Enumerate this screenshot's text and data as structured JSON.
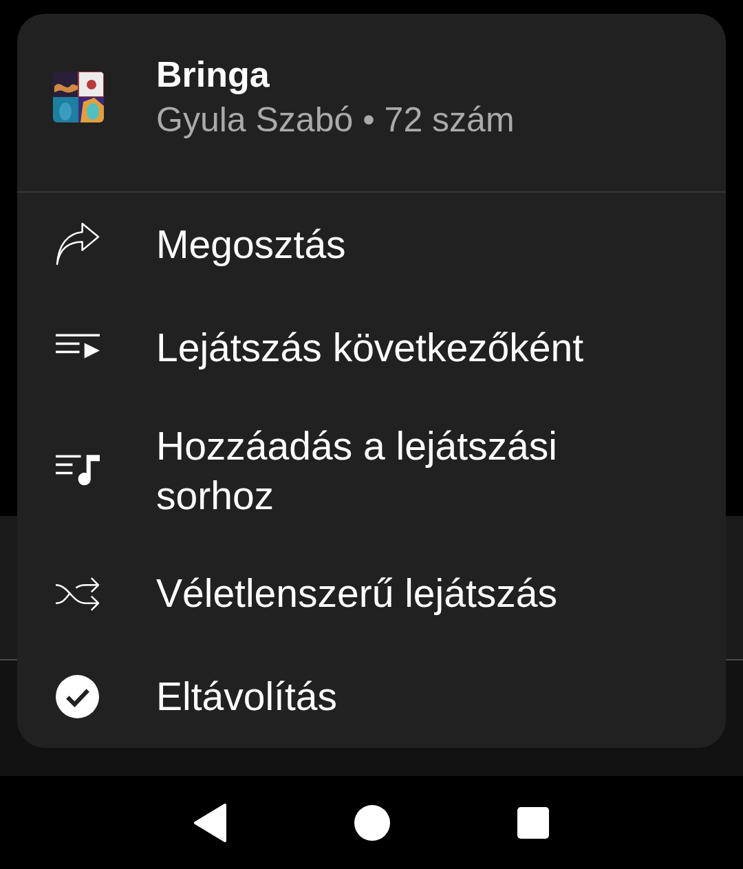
{
  "menu": {
    "header": {
      "title": "Bringa",
      "subtitle": "Gyula Szabó • 72 szám"
    },
    "items": [
      {
        "kind": "share",
        "label": "Megosztás"
      },
      {
        "kind": "play-next",
        "label": "Lejátszás következőként"
      },
      {
        "kind": "add-queue",
        "label": "Hozzáadás a lejátszási sorhoz"
      },
      {
        "kind": "shuffle",
        "label": "Véletlenszerű lejátszás"
      },
      {
        "kind": "remove",
        "label": "Eltávolítás"
      }
    ]
  }
}
